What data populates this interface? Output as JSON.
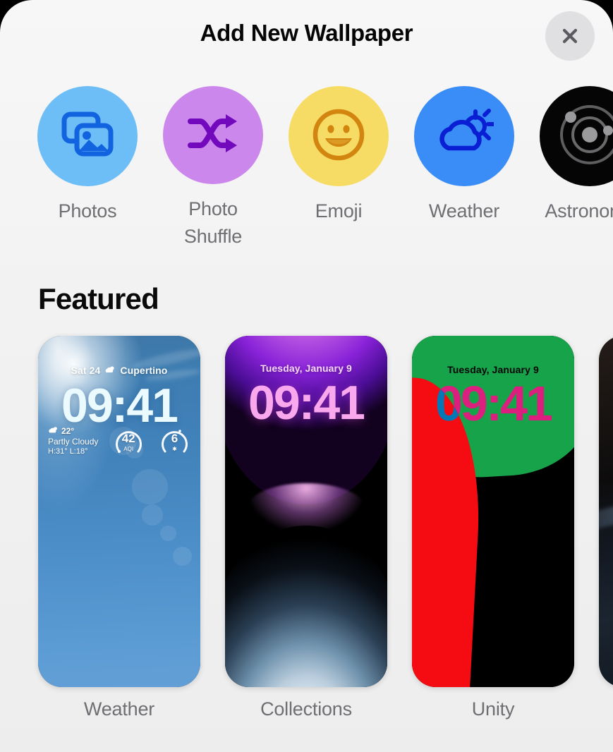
{
  "header": {
    "title": "Add New Wallpaper",
    "close_label": "Close",
    "close_icon": "close-icon"
  },
  "categories": [
    {
      "label": "Photos",
      "icon": "photos-icon",
      "circle_color": "#6dbdf7",
      "glyph_color": "#1263e0"
    },
    {
      "label": "Photo\nShuffle",
      "icon": "shuffle-icon",
      "circle_color": "#cc87ec",
      "glyph_color": "#7209bd"
    },
    {
      "label": "Emoji",
      "icon": "smiley-icon",
      "circle_color": "#f6dc64",
      "glyph_color": "#d2850f"
    },
    {
      "label": "Weather",
      "icon": "cloud-sun-icon",
      "circle_color": "#3a8cf6",
      "glyph_color": "#0a1fd4"
    },
    {
      "label": "Astronomy",
      "icon": "orbit-icon",
      "circle_color": "#050505",
      "glyph_color": "#8c8c8e"
    }
  ],
  "featured": {
    "heading": "Featured",
    "wallpapers": [
      {
        "label": "Weather",
        "date": "Sat 24",
        "location": "Cupertino",
        "time": "09:41",
        "temperature": "22°",
        "condition": "Partly Cloudy",
        "high_low": "H:31° L:18°",
        "aqi_value": "42",
        "aqi_label": "AQI",
        "uv_value": "6",
        "uv_label": "uv-sun-icon"
      },
      {
        "label": "Collections",
        "date": "Tuesday, January 9",
        "time": "09:41"
      },
      {
        "label": "Unity",
        "date": "Tuesday, January 9",
        "time": "09:41"
      },
      {
        "label": ""
      }
    ]
  },
  "colors": {
    "sheet_background": "#f2f2f2",
    "title_text": "#050505",
    "secondary_text": "#6e6e73",
    "close_button_bg": "#e0e0e2",
    "close_icon": "#5c5c60"
  }
}
